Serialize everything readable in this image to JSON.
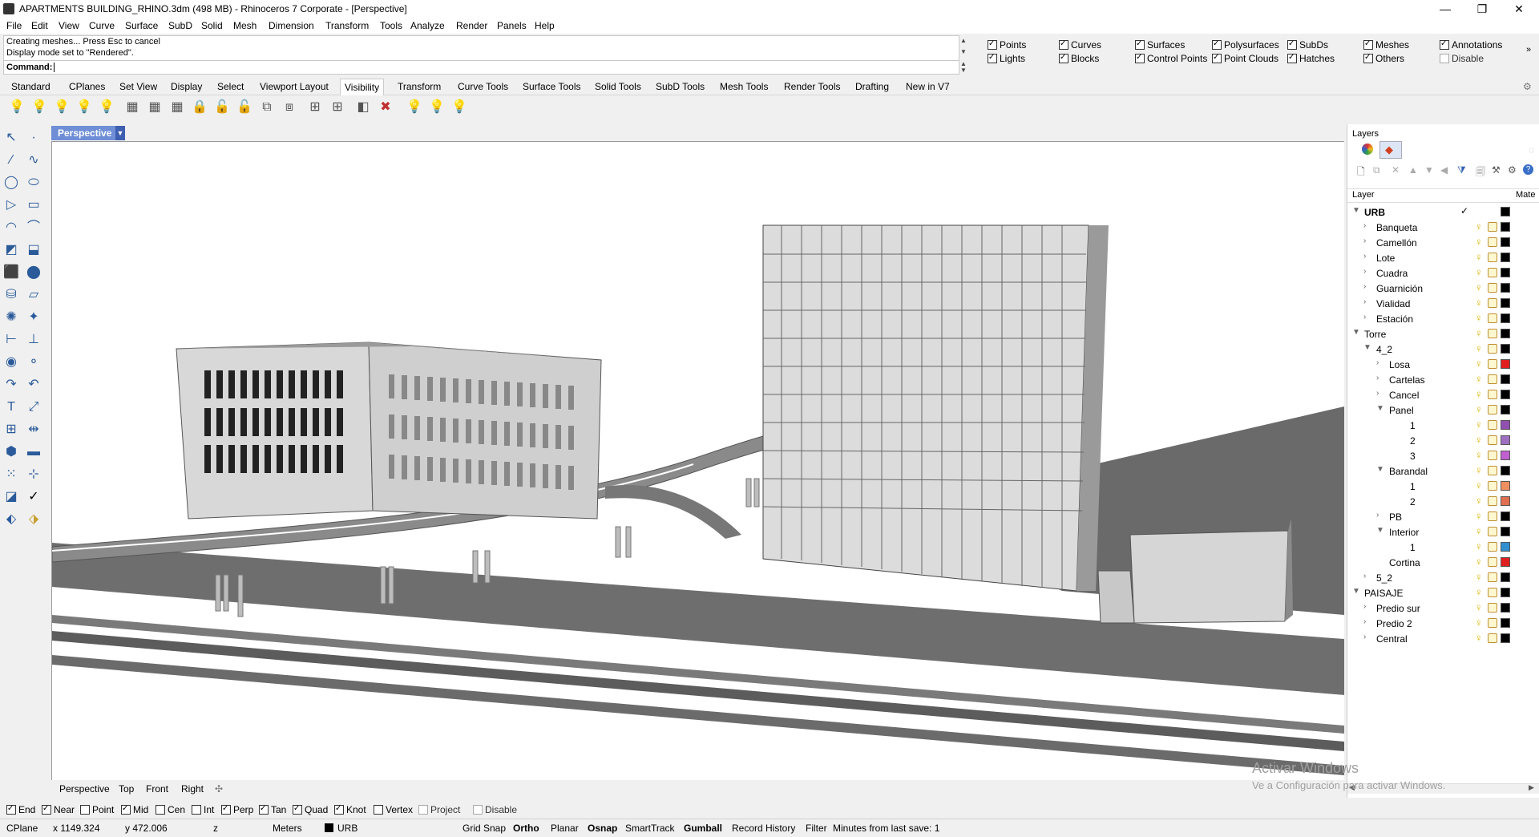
{
  "window": {
    "title": "APARTMENTS BUILDING_RHINO.3dm (498 MB) - Rhinoceros 7 Corporate - [Perspective]",
    "minimize": "—",
    "maximize": "❐",
    "close": "✕"
  },
  "menu": [
    "File",
    "Edit",
    "View",
    "Curve",
    "Surface",
    "SubD",
    "Solid",
    "Mesh",
    "Dimension",
    "Transform",
    "Tools",
    "Analyze",
    "Render",
    "Panels",
    "Help"
  ],
  "command": {
    "history_line1": "Creating meshes... Press Esc to cancel",
    "history_line2": "Display mode set to \"Rendered\".",
    "prompt": "Command:"
  },
  "filters": [
    {
      "label": "Points",
      "checked": true
    },
    {
      "label": "Curves",
      "checked": true
    },
    {
      "label": "Surfaces",
      "checked": true
    },
    {
      "label": "Polysurfaces",
      "checked": true
    },
    {
      "label": "SubDs",
      "checked": true
    },
    {
      "label": "Meshes",
      "checked": true
    },
    {
      "label": "Annotations",
      "checked": true
    },
    {
      "label": "Lights",
      "checked": true
    },
    {
      "label": "Blocks",
      "checked": true
    },
    {
      "label": "Control Points",
      "checked": true
    },
    {
      "label": "Point Clouds",
      "checked": true
    },
    {
      "label": "Hatches",
      "checked": true
    },
    {
      "label": "Others",
      "checked": true
    },
    {
      "label": "Disable",
      "checked": false
    }
  ],
  "tabs": [
    "Standard",
    "CPlanes",
    "Set View",
    "Display",
    "Select",
    "Viewport Layout",
    "Visibility",
    "Transform",
    "Curve Tools",
    "Surface Tools",
    "Solid Tools",
    "SubD Tools",
    "Mesh Tools",
    "Render Tools",
    "Drafting",
    "New in V7"
  ],
  "active_tab": "Visibility",
  "viewport": {
    "title": "Perspective"
  },
  "viewport_tabs": [
    "Perspective",
    "Top",
    "Front",
    "Right"
  ],
  "osnaps": [
    {
      "label": "End",
      "checked": true
    },
    {
      "label": "Near",
      "checked": true
    },
    {
      "label": "Point",
      "checked": false
    },
    {
      "label": "Mid",
      "checked": true
    },
    {
      "label": "Cen",
      "checked": false
    },
    {
      "label": "Int",
      "checked": false
    },
    {
      "label": "Perp",
      "checked": true
    },
    {
      "label": "Tan",
      "checked": true
    },
    {
      "label": "Quad",
      "checked": true
    },
    {
      "label": "Knot",
      "checked": true
    },
    {
      "label": "Vertex",
      "checked": false
    },
    {
      "label": "Project",
      "checked": false
    },
    {
      "label": "Disable",
      "checked": false
    }
  ],
  "status": {
    "cplane": "CPlane",
    "x": "x 1149.324",
    "y": "y 472.006",
    "z": "z",
    "units": "Meters",
    "layer": "URB",
    "grid_snap": "Grid Snap",
    "ortho": "Ortho",
    "planar": "Planar",
    "osnap": "Osnap",
    "smarttrack": "SmartTrack",
    "gumball": "Gumball",
    "record_history": "Record History",
    "filter": "Filter",
    "last_save": "Minutes from last save: 1"
  },
  "layers_panel": {
    "title": "Layers",
    "header_layer": "Layer",
    "header_mat": "Mate",
    "rows": [
      {
        "name": "URB",
        "color": "#000000",
        "bold": true
      },
      {
        "name": "Banqueta",
        "color": "#000000"
      },
      {
        "name": "Camellón",
        "color": "#000000"
      },
      {
        "name": "Lote",
        "color": "#000000"
      },
      {
        "name": "Cuadra",
        "color": "#000000"
      },
      {
        "name": "Guarnición",
        "color": "#000000"
      },
      {
        "name": "Vialidad",
        "color": "#000000"
      },
      {
        "name": "Estación",
        "color": "#000000"
      },
      {
        "name": "Torre",
        "color": "#000000"
      },
      {
        "name": "4_2",
        "color": "#000000"
      },
      {
        "name": "Losa",
        "color": "#e02020"
      },
      {
        "name": "Cartelas",
        "color": "#000000"
      },
      {
        "name": "Cancel",
        "color": "#000000"
      },
      {
        "name": "Panel",
        "color": "#000000"
      },
      {
        "name": "1",
        "color": "#9050b0"
      },
      {
        "name": "2",
        "color": "#a070c0"
      },
      {
        "name": "3",
        "color": "#c060d0"
      },
      {
        "name": "Barandal",
        "color": "#000000"
      },
      {
        "name": "1",
        "color": "#f09060"
      },
      {
        "name": "2",
        "color": "#e07050"
      },
      {
        "name": "PB",
        "color": "#000000"
      },
      {
        "name": "Interior",
        "color": "#000000"
      },
      {
        "name": "1",
        "color": "#3090d0"
      },
      {
        "name": "Cortina",
        "color": "#e02020"
      },
      {
        "name": "5_2",
        "color": "#000000"
      },
      {
        "name": "PAISAJE",
        "color": "#000000"
      },
      {
        "name": "Predio sur",
        "color": "#000000"
      },
      {
        "name": "Predio 2",
        "color": "#000000"
      },
      {
        "name": "Central",
        "color": "#000000"
      }
    ]
  },
  "watermark": {
    "line1": "Activar Windows",
    "line2": "Ve a Configuración para activar Windows."
  }
}
